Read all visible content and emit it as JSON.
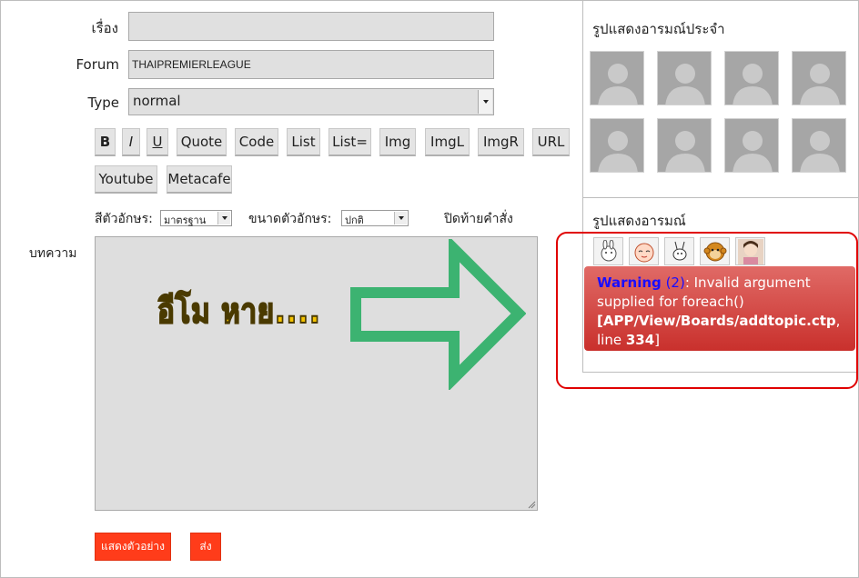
{
  "form": {
    "subject_label": "เรื่อง",
    "subject_value": "",
    "forum_label": "Forum",
    "forum_value": "THAIPREMIERLEAGUE",
    "type_label": "Type",
    "type_value": "normal"
  },
  "toolbar": {
    "buttons": [
      "B",
      "I",
      "U",
      "Quote",
      "Code",
      "List",
      "List=",
      "Img",
      "ImgL",
      "ImgR",
      "URL",
      "Youtube",
      "Metacafe"
    ]
  },
  "font_options": {
    "color_label": "สีตัวอักษร:",
    "color_value": "มาตรฐาน",
    "size_label": "ขนาดตัวอักษร:",
    "size_value": "ปกติ",
    "close_tags_label": "ปิดท้ายคำสั่ง"
  },
  "content": {
    "label": "บทความ",
    "annotation_text": "อีโม หาย....",
    "annotation_text_color": "#f5c400",
    "arrow_color": "#3cb371"
  },
  "actions": {
    "preview_label": "แสดงตัวอย่าง",
    "submit_label": "ส่ง",
    "button_color": "#ff3c1a"
  },
  "sidebar": {
    "fixed_avatars_title": "รูปแสดงอารมณ์ประจำ",
    "avatar_count": 8,
    "emoticons_title": "รูปแสดงอารมณ์",
    "emoticons": [
      "rabbit-emoticon-icon",
      "onion-face-emoticon-icon",
      "stick-rabbit-emoticon-icon",
      "monkey-emoticon-icon",
      "girl-photo-emoticon-icon"
    ]
  },
  "warning": {
    "title": "Warning",
    "code": "(2)",
    "message": ": Invalid argument supplied for foreach()",
    "location": "[APP/View/Boards/addtopic.ctp",
    "line_label": ", line ",
    "line_number": "334",
    "close_bracket": "]",
    "color": "#d9534f",
    "highlight_color": "#e00000"
  }
}
